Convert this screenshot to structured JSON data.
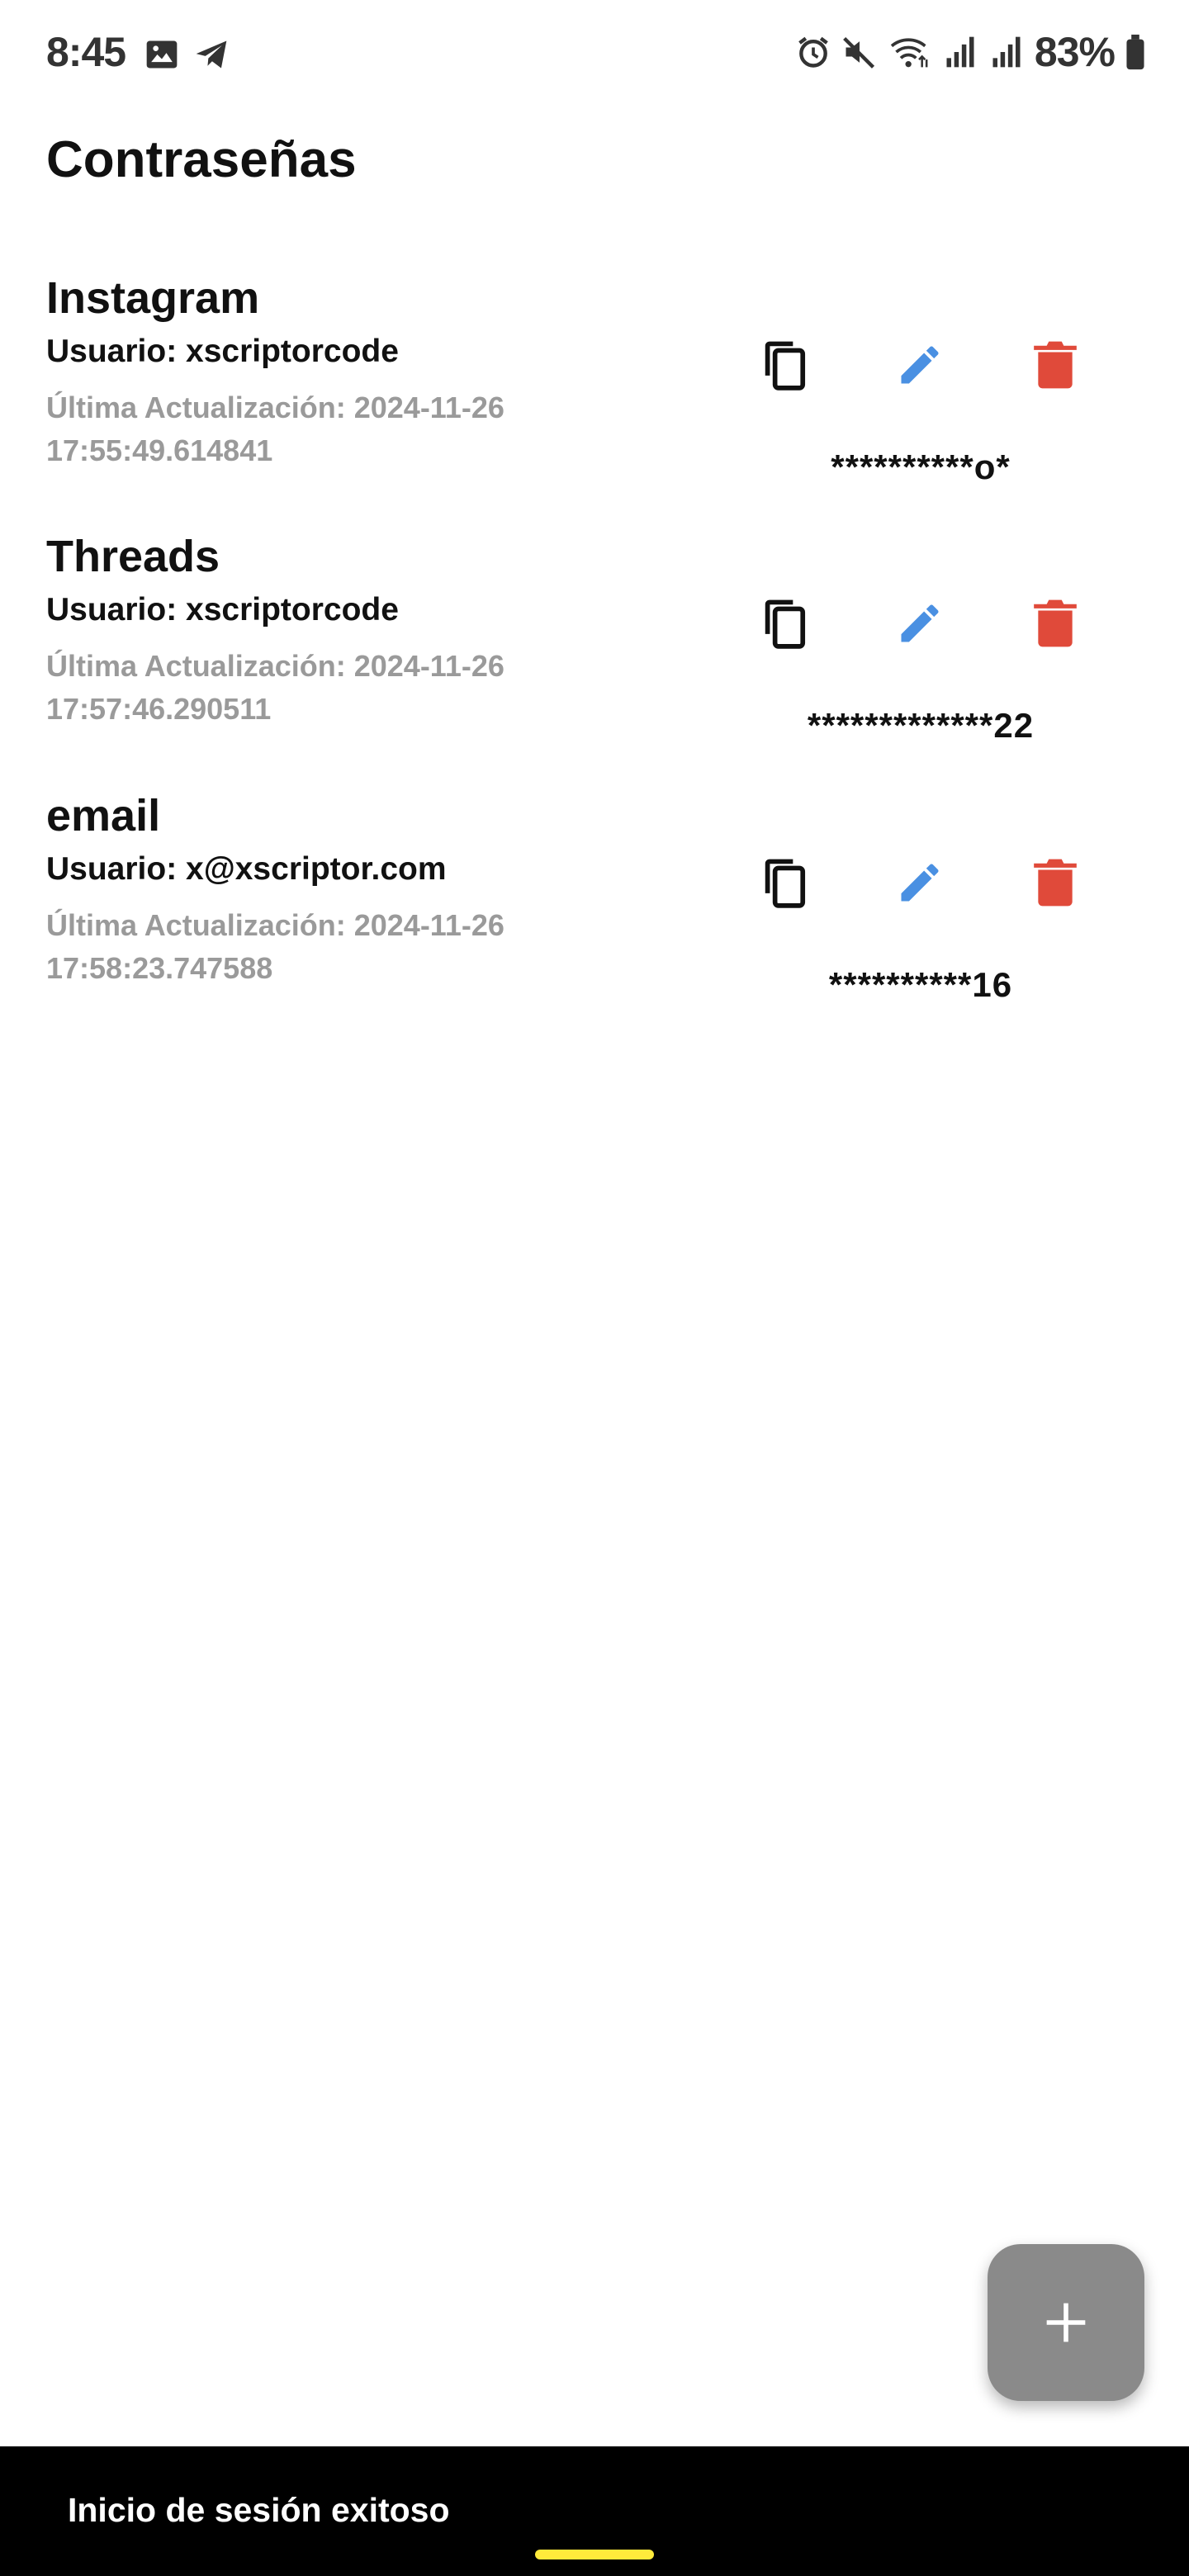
{
  "status_bar": {
    "time": "8:45",
    "battery": "83%",
    "icons": [
      "gallery-icon",
      "telegram-icon",
      "alarm-icon",
      "mute-icon",
      "wifi-icon",
      "signal-icon",
      "signal-icon",
      "battery-icon"
    ]
  },
  "page": {
    "title": "Contraseñas"
  },
  "entries": [
    {
      "name": "Instagram",
      "user": "Usuario: xscriptorcode",
      "updated": "Última Actualización: 2024-11-26 17:55:49.614841",
      "password": "**********o*"
    },
    {
      "name": "Threads",
      "user": "Usuario: xscriptorcode",
      "updated": "Última Actualización: 2024-11-26 17:57:46.290511",
      "password": "*************22"
    },
    {
      "name": "email",
      "user": "Usuario: x@xscriptor.com",
      "updated": "Última Actualización: 2024-11-26 17:58:23.747588",
      "password": "**********16"
    }
  ],
  "actions": {
    "copy_icon": "copy-icon",
    "edit_icon": "edit-icon",
    "delete_icon": "delete-icon"
  },
  "colors": {
    "edit": "#4a90e2",
    "delete": "#e04a3a",
    "fab": "#8a8a8a",
    "snackbar": "#000000",
    "nav_handle": "#ffeb3b"
  },
  "fab": {
    "icon": "plus-icon"
  },
  "snackbar": {
    "message": "Inicio de sesión exitoso"
  }
}
